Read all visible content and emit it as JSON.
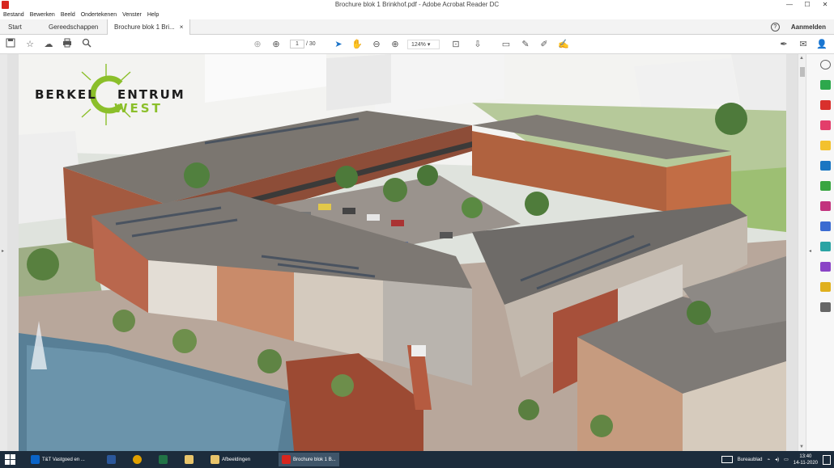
{
  "window": {
    "title": "Brochure blok 1 Brinkhof.pdf - Adobe Acrobat Reader DC",
    "controls": [
      "—",
      "☐",
      "✕"
    ]
  },
  "menu": [
    "Bestand",
    "Bewerken",
    "Beeld",
    "Ondertekenen",
    "Venster",
    "Help"
  ],
  "tabs": {
    "start": "Start",
    "tools": "Gereedschappen",
    "document": "Brochure blok 1 Bri...",
    "close": "×",
    "help": "?",
    "signin": "Aanmelden"
  },
  "toolbar": {
    "page_current": "1",
    "page_total": "/ 30",
    "zoom": "124%"
  },
  "pdf": {
    "logo_line1_left": "BERKEL",
    "logo_line1_right": "ENTRUM",
    "logo_line2": "WEST",
    "logo_c": "C"
  },
  "taskbar": {
    "apps": [
      {
        "label": "T&T Vastgoed en ...",
        "color": "#0a64c8"
      },
      {
        "label": "",
        "color": "#2b579a"
      },
      {
        "label": "",
        "color": "#e0a000"
      },
      {
        "label": "",
        "color": "#217346"
      },
      {
        "label": "",
        "color": "#e8c46a"
      },
      {
        "label": "Afbeeldingen",
        "color": "#e8c46a"
      },
      {
        "label": "Brochure blok 1 B...",
        "color": "#d7261e"
      }
    ],
    "desktop_label": "Bureaublad",
    "time": "13:40",
    "date": "14-11-2020"
  },
  "colors": {
    "brick": "#a5503a",
    "roof": "#8d8a86",
    "logo_green": "#8bbf2a",
    "acrobat_red": "#d7261e"
  }
}
